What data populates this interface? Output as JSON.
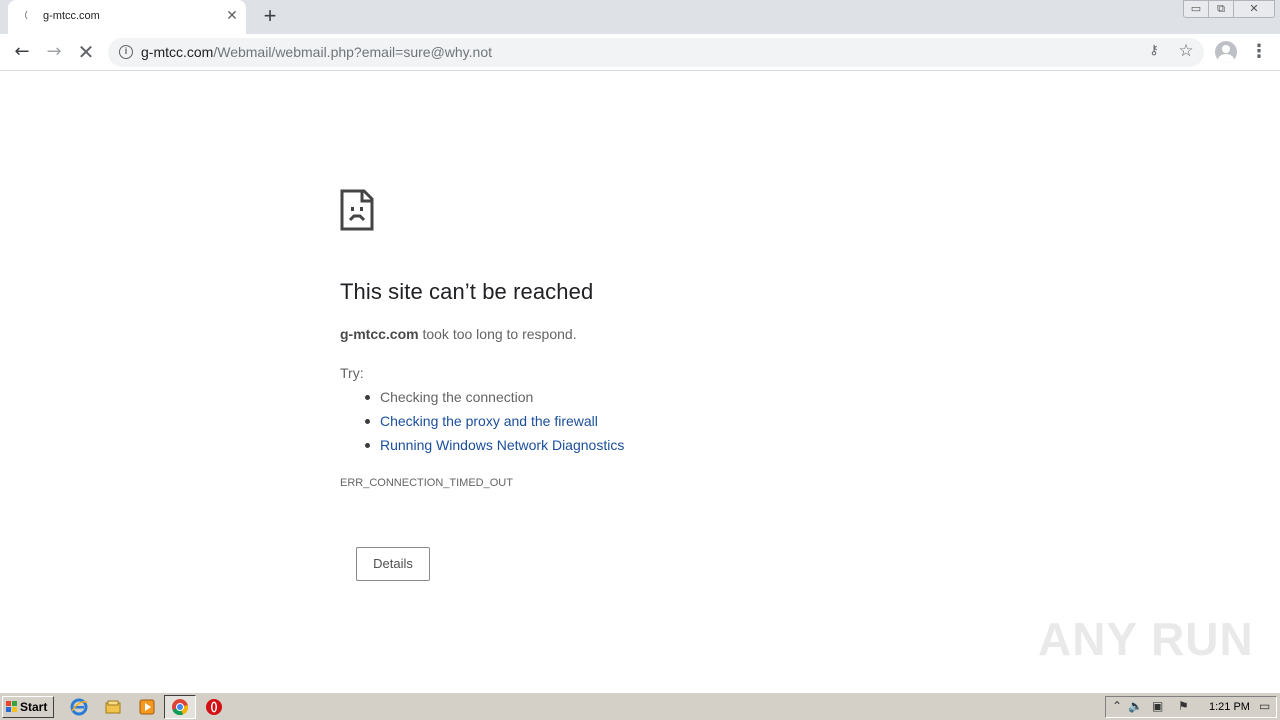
{
  "tab": {
    "title": "g-mtcc.com",
    "close_glyph": "✕"
  },
  "new_tab_glyph": "+",
  "window_controls": {
    "minimize": "▭",
    "maximize": "⧉",
    "close": "✕"
  },
  "toolbar": {
    "back_glyph": "←",
    "forward_glyph": "→",
    "stop_glyph": "✕",
    "url_host": "g-mtcc.com",
    "url_path": "/Webmail/webmail.php?email=sure@why.not",
    "info_glyph": "i",
    "key_glyph": "⚷",
    "star_glyph": "☆",
    "menu_glyph": "⋮"
  },
  "error": {
    "title": "This site can’t be reached",
    "host": "g-mtcc.com",
    "message": " took too long to respond.",
    "try_label": "Try:",
    "suggestions": [
      {
        "text": "Checking the connection",
        "link": false
      },
      {
        "text": "Checking the proxy and the firewall",
        "link": true
      },
      {
        "text": "Running Windows Network Diagnostics",
        "link": true
      }
    ],
    "code": "ERR_CONNECTION_TIMED_OUT",
    "details_button": "Details"
  },
  "watermark": "ANY RUN",
  "taskbar": {
    "start_label": "Start",
    "clock": "1:21 PM",
    "icons": [
      "ie-icon",
      "explorer-icon",
      "media-player-icon",
      "chrome-icon",
      "opera-icon"
    ]
  },
  "colors": {
    "tabstrip_bg": "#dee1e6",
    "link": "#1a4e9c",
    "text_gray": "#646464",
    "taskbar_bg": "#d4d0c8"
  }
}
